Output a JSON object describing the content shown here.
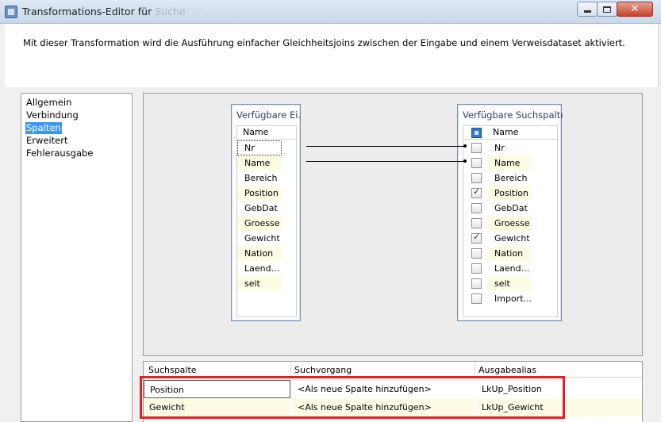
{
  "window": {
    "title": "Transformations-Editor für Suche"
  },
  "description": "Mit dieser Transformation wird die Ausführung einfacher Gleichheitsjoins zwischen der Eingabe und einem Verweisdataset aktiviert.",
  "nav": {
    "items": [
      {
        "label": "Allgemein",
        "selected": false
      },
      {
        "label": "Verbindung",
        "selected": false
      },
      {
        "label": "Spalten",
        "selected": true
      },
      {
        "label": "Erweitert",
        "selected": false
      },
      {
        "label": "Fehlerausgabe",
        "selected": false
      }
    ]
  },
  "input_columns": {
    "title": "Verfügbare Ei...",
    "header": "Name",
    "rows": [
      "Nr",
      "Name",
      "Bereich",
      "Position",
      "GebDat",
      "Groesse",
      "Gewicht",
      "Nation",
      "Laend...",
      "seit"
    ]
  },
  "lookup_columns": {
    "title": "Verfügbare Suchspalten",
    "header": "Name",
    "rows": [
      {
        "name": "Nr",
        "checked": false
      },
      {
        "name": "Name",
        "checked": false
      },
      {
        "name": "Bereich",
        "checked": false
      },
      {
        "name": "Position",
        "checked": true
      },
      {
        "name": "GebDat",
        "checked": false
      },
      {
        "name": "Groesse",
        "checked": false
      },
      {
        "name": "Gewicht",
        "checked": true
      },
      {
        "name": "Nation",
        "checked": false
      },
      {
        "name": "Laend...",
        "checked": false
      },
      {
        "name": "seit",
        "checked": false
      },
      {
        "name": "Import...",
        "checked": false
      }
    ]
  },
  "mapping": {
    "headers": [
      "Suchspalte",
      "Suchvorgang",
      "Ausgabealias"
    ],
    "rows": [
      {
        "lookup_column": "Position",
        "operation": "<Als neue Spalte hinzufügen>",
        "alias": "LkUp_Position"
      },
      {
        "lookup_column": "Gewicht",
        "operation": "<Als neue Spalte hinzufügen>",
        "alias": "LkUp_Gewicht"
      }
    ]
  },
  "colors": {
    "selection": "#3399ff",
    "row_tint": "#fdfbe3",
    "highlight": "#e3202a"
  }
}
